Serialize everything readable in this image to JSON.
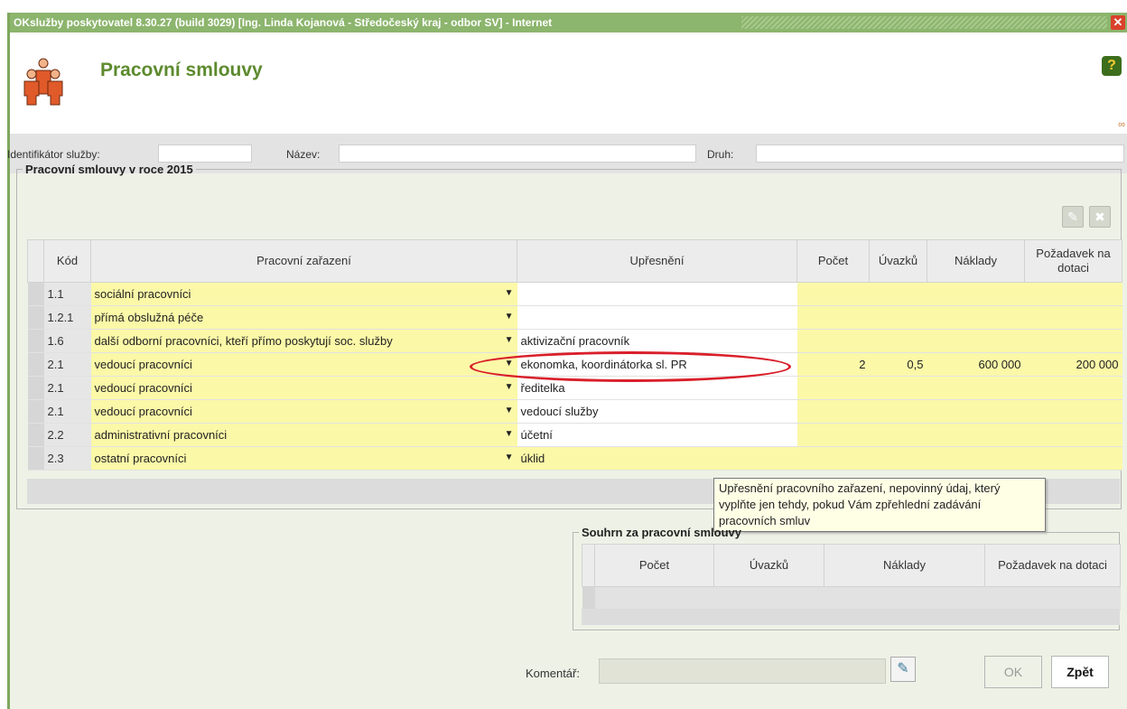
{
  "window": {
    "title": "OKslužby poskytovatel 8.30.27 (build 3029)  [Ing. Linda Kojanová - Středočeský kraj - odbor SV] - Internet",
    "close_icon": "close-icon"
  },
  "header": {
    "page_title": "Pracovní smlouvy",
    "help_icon": "?"
  },
  "ident": {
    "id_label": "Identifikátor služby:",
    "name_label": "Název:",
    "type_label": "Druh:"
  },
  "contracts": {
    "legend": "Pracovní smlouvy v roce 2015",
    "columns": [
      "Kód",
      "Pracovní zařazení",
      "Upřesnění",
      "Počet",
      "Úvazků",
      "Náklady",
      "Požadavek na dotaci"
    ],
    "rows": [
      {
        "code": "1.1",
        "position": "sociální pracovníci",
        "detail": "",
        "count": "",
        "load": "",
        "costs": "",
        "subsidy": ""
      },
      {
        "code": "1.2.1",
        "position": "přímá obslužná péče",
        "detail": "",
        "count": "",
        "load": "",
        "costs": "",
        "subsidy": ""
      },
      {
        "code": "1.6",
        "position": "další odborní pracovníci, kteří přímo poskytují soc. služby",
        "detail": "aktivizační pracovník",
        "count": "",
        "load": "",
        "costs": "",
        "subsidy": ""
      },
      {
        "code": "2.1",
        "position": "vedoucí pracovníci",
        "detail": "ekonomka, koordinátorka sl. PR",
        "count": "2",
        "load": "0,5",
        "costs": "600 000",
        "subsidy": "200 000"
      },
      {
        "code": "2.1",
        "position": "vedoucí pracovníci",
        "detail": "ředitelka",
        "count": "",
        "load": "",
        "costs": "",
        "subsidy": ""
      },
      {
        "code": "2.1",
        "position": "vedoucí pracovníci",
        "detail": "vedoucí služby",
        "count": "",
        "load": "",
        "costs": "",
        "subsidy": ""
      },
      {
        "code": "2.2",
        "position": "administrativní pracovníci",
        "detail": "účetní",
        "count": "",
        "load": "",
        "costs": "",
        "subsidy": ""
      },
      {
        "code": "2.3",
        "position": "ostatní pracovníci",
        "detail": "úklid",
        "count": "",
        "load": "",
        "costs": "",
        "subsidy": ""
      }
    ]
  },
  "tooltip": "Upřesnění pracovního zařazení, nepovinný údaj, který vyplňte jen tehdy, pokud Vám zpřehlední zadávání pracovních smluv",
  "summary": {
    "legend": "Souhrn za pracovní smlouvy",
    "columns": [
      "Počet",
      "Úvazků",
      "Náklady",
      "Požadavek na dotaci"
    ]
  },
  "footer": {
    "comment_label": "Komentář:",
    "ok_label": "OK",
    "back_label": "Zpět"
  },
  "colors": {
    "title_bar": "#8cb56d",
    "accent": "#5d8a2e",
    "highlight": "#fbf8a8",
    "annotation": "#d91f2a"
  }
}
